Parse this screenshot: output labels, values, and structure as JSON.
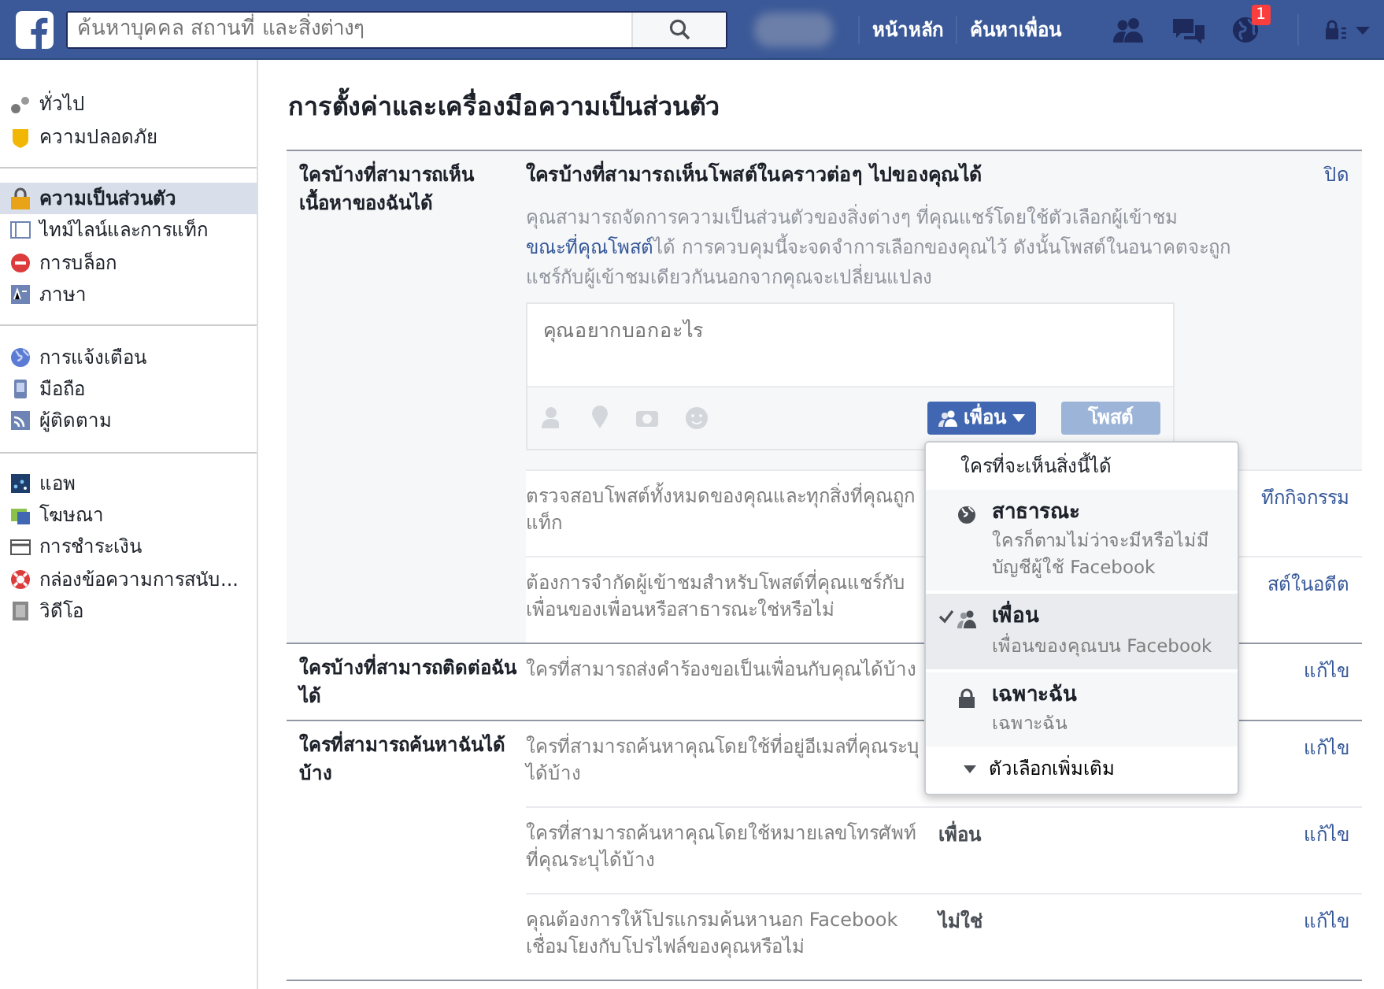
{
  "topbar": {
    "search": {
      "placeholder": "ค้นหาบุคคล สถานที่ และสิ่งต่างๆ"
    },
    "nav": [
      "หน้าหลัก",
      "ค้นหาเพื่อน"
    ],
    "notification_count": "1"
  },
  "sidebar": {
    "groups": [
      [
        {
          "label": "ทั่วไป",
          "selected": false
        },
        {
          "label": "ความปลอดภัย",
          "selected": false
        }
      ],
      [
        {
          "label": "ความเป็นส่วนตัว",
          "selected": true
        },
        {
          "label": "ไทม์ไลน์และการแท็ก",
          "selected": false
        },
        {
          "label": "การบล็อก",
          "selected": false
        },
        {
          "label": "ภาษา",
          "selected": false
        }
      ],
      [
        {
          "label": "การแจ้งเตือน",
          "selected": false
        },
        {
          "label": "มือถือ",
          "selected": false
        },
        {
          "label": "ผู้ติดตาม",
          "selected": false
        }
      ],
      [
        {
          "label": "แอพ",
          "selected": false
        },
        {
          "label": "โฆษณา",
          "selected": false
        },
        {
          "label": "การชำระเงิน",
          "selected": false
        },
        {
          "label": "กล่องข้อความการสนับ...",
          "selected": false
        },
        {
          "label": "วิดีโอ",
          "selected": false
        }
      ]
    ]
  },
  "page_title": "การตั้งค่าและเครื่องมือความเป็นส่วนตัว",
  "sections": [
    {
      "title": "ใครบ้างที่สามารถเห็นเนื้อหาของฉันได้",
      "editor": {
        "heading": "ใครบ้างที่สามารถเห็นโพสต์ในคราวต่อๆ ไปของคุณได้",
        "close": "ปิด",
        "text_before": "คุณสามารถจัดการความเป็นส่วนตัวของสิ่งต่างๆ ที่คุณแชร์โดยใช้ตัวเลือกผู้เข้าชม ",
        "link": "ขณะที่คุณโพสต์",
        "text_after": "ได้ การควบคุมนี้จะจดจำการเลือกของคุณไว้ ดังนั้นโพสต์ในอนาคตจะถูกแชร์กับผู้เข้าชมเดียวกันนอกจากคุณจะเปลี่ยนแปลง",
        "composer": {
          "placeholder": "คุณอยากบอกอะไร",
          "audience_button": "เพื่อน",
          "post_button": "โพสต์",
          "post_disabled": true
        }
      },
      "rows": [
        {
          "description": "ตรวจสอบโพสต์ทั้งหมดของคุณและทุกสิ่งที่คุณถูกแท็ก",
          "action": "ทึกกิจกรรม"
        },
        {
          "description": "ต้องการจำกัดผู้เข้าชมสำหรับโพสต์ที่คุณแชร์กับเพื่อนของเพื่อนหรือสาธารณะใช่หรือไม่",
          "action": "สต์ในอดีต"
        }
      ]
    },
    {
      "title": "ใครบ้างที่สามารถติดต่อฉันได้",
      "rows": [
        {
          "description": "ใครที่สามารถส่งคำร้องขอเป็นเพื่อนกับคุณได้บ้าง",
          "action": "แก้ไข"
        }
      ]
    },
    {
      "title": "ใครที่สามารถค้นหาฉันได้บ้าง",
      "rows": [
        {
          "description": "ใครที่สามารถค้นหาคุณโดยใช้ที่อยู่อีเมลที่คุณระบุได้บ้าง",
          "action": "แก้ไข"
        },
        {
          "description": "ใครที่สามารถค้นหาคุณโดยใช้หมายเลขโทรศัพท์ที่คุณระบุได้บ้าง",
          "value": "เพื่อน",
          "action": "แก้ไข"
        },
        {
          "description": "คุณต้องการให้โปรแกรมค้นหานอก Facebook เชื่อมโยงกับโปรไฟล์ของคุณหรือไม่",
          "value": "ไม่ใช่",
          "action": "แก้ไข"
        }
      ]
    }
  ],
  "audience_menu": {
    "header": "ใครที่จะเห็นสิ่งนี้ได้",
    "options": [
      {
        "kind": "public",
        "title": "สาธารณะ",
        "subtitle": "ใครก็ตามไม่ว่าจะมีหรือไม่มีบัญชีผู้ใช้ Facebook",
        "selected": false
      },
      {
        "kind": "friends",
        "title": "เพื่อน",
        "subtitle": "เพื่อนของคุณบน Facebook",
        "selected": true
      },
      {
        "kind": "only_me",
        "title": "เฉพาะฉัน",
        "subtitle": "เฉพาะฉัน",
        "selected": false
      }
    ],
    "more": "ตัวเลือกเพิ่มเติม"
  }
}
